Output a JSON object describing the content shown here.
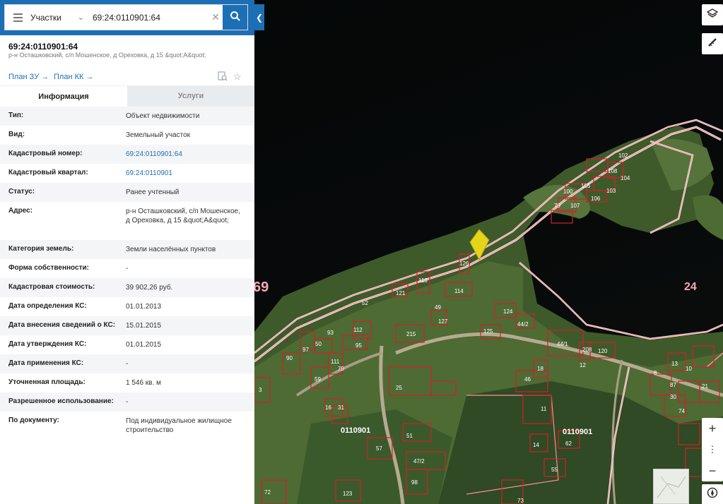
{
  "search": {
    "category": "Участки",
    "query": "69:24:0110901:64"
  },
  "object": {
    "title": "69:24:0110901:64",
    "subtitle": "р-н Осташковский, с/п Мошенское, д Ореховка, д 15 &quot;А&quot;",
    "plan_zu": "План ЗУ →",
    "plan_kk": "План КК →"
  },
  "tabs": {
    "info": "Информация",
    "services": "Услуги"
  },
  "info_rows": [
    {
      "label": "Тип:",
      "value": "Объект недвижимости"
    },
    {
      "label": "Вид:",
      "value": "Земельный участок"
    },
    {
      "label": "Кадастровый номер:",
      "value": "69:24:0110901:64"
    },
    {
      "label": "Кадастровый квартал:",
      "value": "69:24:0110901"
    },
    {
      "label": "Статус:",
      "value": "Ранее учтенный"
    },
    {
      "label": "Адрес:",
      "value": "р-н Осташковский, с/п Мошенское, д Ореховка, д 15 &quot;А&quot;"
    },
    {
      "label": "Категория земель:",
      "value": "Земли населённых пунктов"
    },
    {
      "label": "Форма собственности:",
      "value": "-"
    },
    {
      "label": "Кадастровая стоимость:",
      "value": "39 902,26 руб."
    },
    {
      "label": "Дата определения КС:",
      "value": "01.01.2013"
    },
    {
      "label": "Дата внесения сведений о КС:",
      "value": "15.01.2015"
    },
    {
      "label": "Дата утверждения КС:",
      "value": "01.01.2015"
    },
    {
      "label": "Дата применения КС:",
      "value": "-"
    },
    {
      "label": "Уточненная площадь:",
      "value": "1 546 кв. м"
    },
    {
      "label": "Разрешенное использование:",
      "value": "-"
    },
    {
      "label": "По документу:",
      "value": "Под индивидуальное жилищное строительство"
    }
  ],
  "map": {
    "quarter_left": "0110901",
    "quarter_right": "0110901",
    "district_24": "24",
    "district_69": "69",
    "parcels": [
      "102",
      "108",
      "104",
      "103",
      "105",
      "106",
      "100",
      "107",
      "79",
      "64",
      "114",
      "113",
      "121",
      "124",
      "44/2",
      "125",
      "127",
      "126",
      "215",
      "112",
      "95",
      "44/1",
      "120",
      "208",
      "97",
      "59",
      "31",
      "90",
      "91",
      "93",
      "81",
      "25",
      "25",
      "46",
      "18",
      "51",
      "47/2",
      "98",
      "123",
      "57",
      "72",
      "55",
      "62",
      "14",
      "16",
      "87",
      "74",
      "52",
      "13",
      "21",
      "49",
      "73"
    ]
  },
  "controls": {
    "zoom_in": "+",
    "zoom_more": "⋮",
    "zoom_out": "−"
  },
  "colors": {
    "accent": "#1d6fb5",
    "boundary": "#ff8d98",
    "parcel": "#d31f2d",
    "selected": "#e5d51a"
  }
}
